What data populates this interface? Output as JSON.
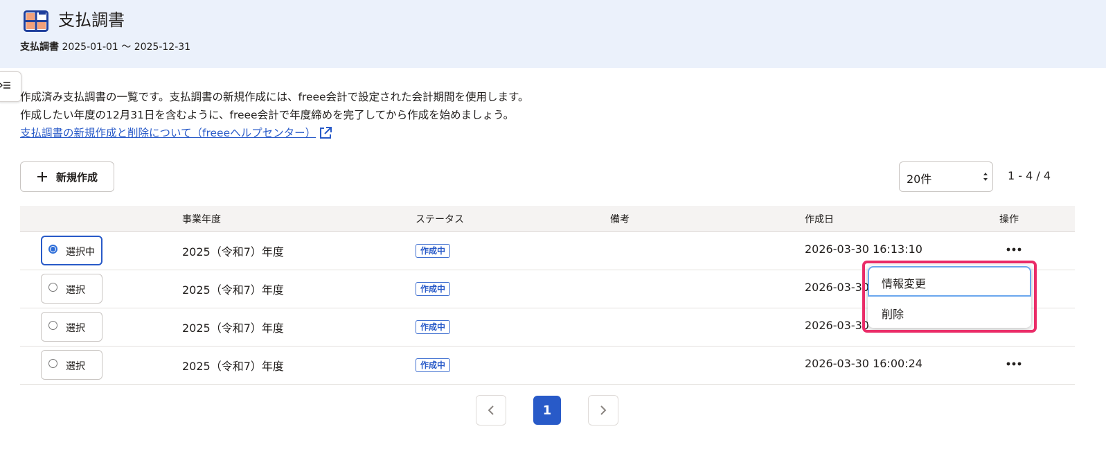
{
  "header": {
    "title": "支払調書",
    "sub_bold": "支払調書",
    "period": "2025-01-01 〜 2025-12-31"
  },
  "description": {
    "line1": "作成済み支払調書の一覧です。支払調書の新規作成には、freee会計で設定された会計期間を使用します。",
    "line2": "作成したい年度の12月31日を含むように、freee会計で年度締めを完了してから作成を始めましょう。",
    "help_link": "支払調書の新規作成と削除について（freeeヘルプセンター）"
  },
  "toolbar": {
    "new_label": "新規作成",
    "per_page": "20件",
    "range": "1 - 4 / 4"
  },
  "table": {
    "headers": [
      "事業年度",
      "ステータス",
      "備考",
      "作成日",
      "操作"
    ],
    "rows": [
      {
        "select": "選択中",
        "fiscal_year": "2025（令和7）年度",
        "status": "作成中",
        "note": "",
        "created": "2026-03-30 16:13:10",
        "selected": true
      },
      {
        "select": "選択",
        "fiscal_year": "2025（令和7）年度",
        "status": "作成中",
        "note": "",
        "created": "2026-03-30",
        "selected": false
      },
      {
        "select": "選択",
        "fiscal_year": "2025（令和7）年度",
        "status": "作成中",
        "note": "",
        "created": "2026-03-30",
        "selected": false
      },
      {
        "select": "選択",
        "fiscal_year": "2025（令和7）年度",
        "status": "作成中",
        "note": "",
        "created": "2026-03-30 16:00:24",
        "selected": false
      }
    ]
  },
  "action_menu": {
    "items": [
      "情報変更",
      "削除"
    ]
  },
  "pagination": {
    "current": "1"
  },
  "colors": {
    "primary": "#285ac8",
    "header_bg": "#ebf1fb",
    "highlight": "#ea2c68",
    "icon_orange": "#f2a07a"
  },
  "icons": {
    "app": "payment-record-icon",
    "sidebar": "sidebar-expand-icon",
    "external": "external-link-icon",
    "plus": "plus-icon",
    "more": "more-horizontal-icon",
    "prev": "chevron-left-icon",
    "next": "chevron-right-icon"
  }
}
